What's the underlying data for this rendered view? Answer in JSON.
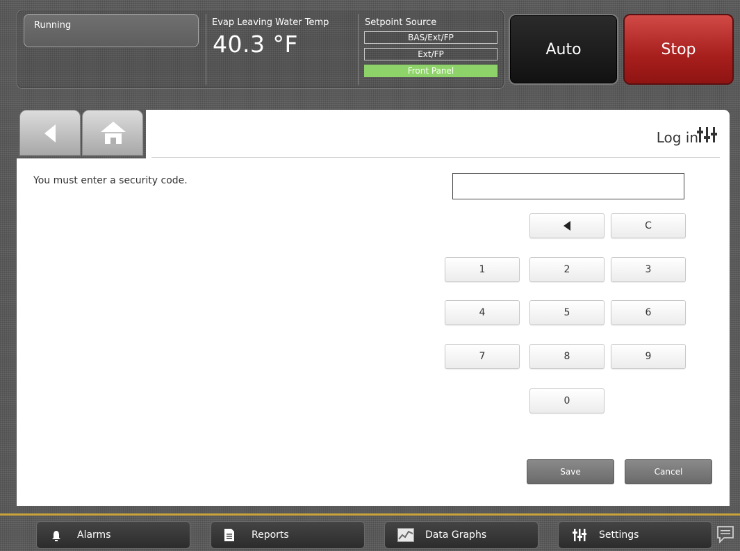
{
  "status": {
    "state": "Running",
    "evap_label": "Evap Leaving Water Temp",
    "evap_value": "40.3 °F",
    "setpoint_label": "Setpoint Source",
    "setpoint_options": [
      "BAS/Ext/FP",
      "Ext/FP",
      "Front Panel"
    ],
    "setpoint_active": "Front Panel"
  },
  "controls": {
    "auto_label": "Auto",
    "stop_label": "Stop"
  },
  "nav": {
    "back_icon": "back-arrow-icon",
    "home_icon": "home-icon"
  },
  "page": {
    "title": "Log in",
    "title_icon": "settings-sliders-icon",
    "prompt": "You must enter a security code.",
    "code_value": ""
  },
  "keypad": {
    "backspace_icon": "backspace-arrow-icon",
    "clear": "C",
    "keys": [
      "1",
      "2",
      "3",
      "4",
      "5",
      "6",
      "7",
      "8",
      "9",
      "0"
    ]
  },
  "actions": {
    "save": "Save",
    "cancel": "Cancel"
  },
  "bottom_nav": [
    {
      "label": "Alarms",
      "icon": "bell-icon"
    },
    {
      "label": "Reports",
      "icon": "document-icon"
    },
    {
      "label": "Data Graphs",
      "icon": "graph-icon"
    },
    {
      "label": "Settings",
      "icon": "sliders-icon"
    }
  ],
  "colors": {
    "stop": "#b52a27",
    "auto": "#1a1a1a",
    "active_setpoint": "#8ed36a",
    "accent_line": "#c9a23a"
  }
}
